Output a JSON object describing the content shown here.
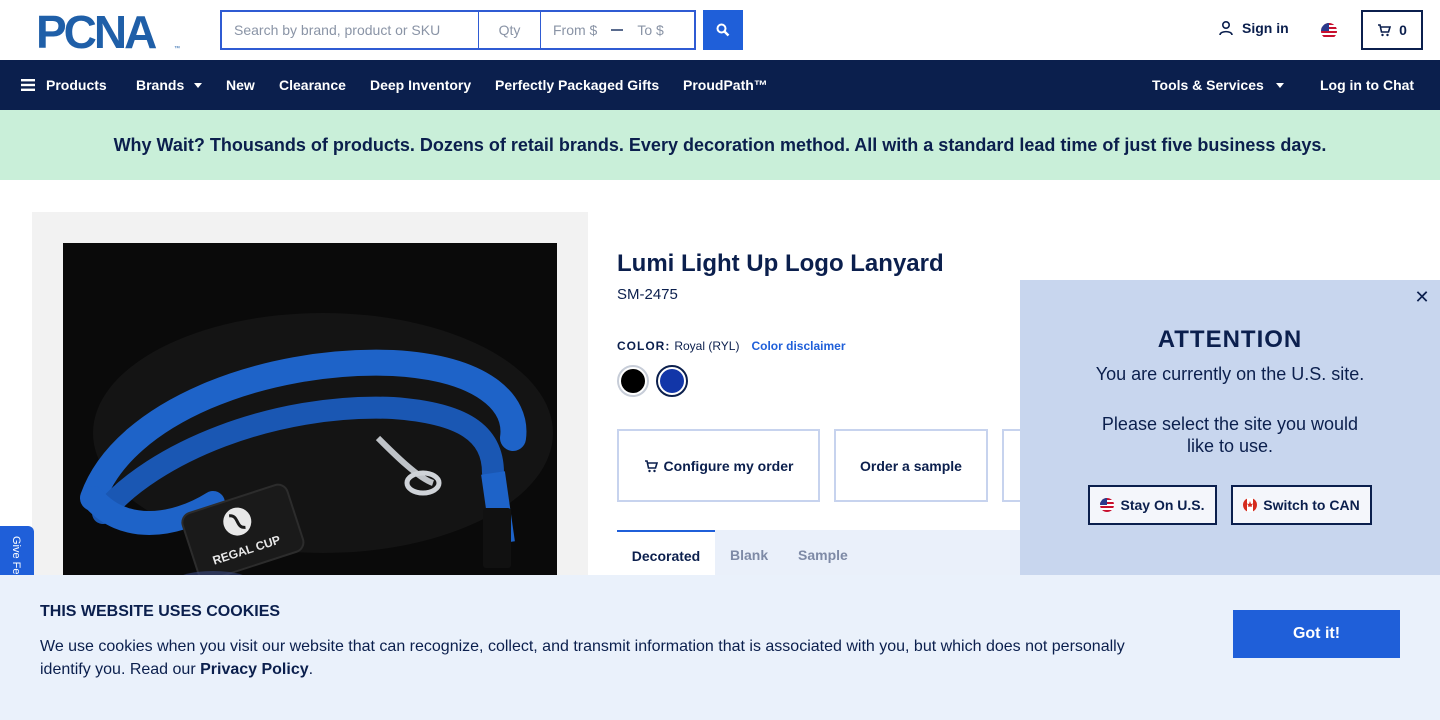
{
  "header": {
    "logo_text": "PCNA",
    "search_placeholder": "Search by brand, product or SKU",
    "qty_placeholder": "Qty",
    "from_placeholder": "From $",
    "to_placeholder": "To $",
    "sign_in": "Sign in",
    "cart_count": "0"
  },
  "nav": {
    "products": "Products",
    "brands": "Brands",
    "new": "New",
    "clearance": "Clearance",
    "deep_inventory": "Deep Inventory",
    "gifts": "Perfectly Packaged Gifts",
    "proudpath": "ProudPath™",
    "tools": "Tools & Services",
    "chat": "Log in to Chat"
  },
  "banner": {
    "text": "Why Wait? Thousands of products. Dozens of retail brands. Every decoration method. All with a standard lead time of just five business days."
  },
  "product": {
    "title": "Lumi Light Up Logo Lanyard",
    "sku": "SM-2475",
    "color_label": "COLOR:",
    "color_value": "Royal (RYL)",
    "color_disclaimer": "Color disclaimer",
    "swatches": [
      {
        "name": "Black",
        "color": "#000000"
      },
      {
        "name": "Royal",
        "color": "#1236a8"
      }
    ],
    "image_logo_text": "REGAL CUP",
    "actions": {
      "configure": "Configure my order",
      "sample": "Order a sample"
    },
    "tabs": [
      "Decorated",
      "Blank",
      "Sample"
    ]
  },
  "feedback": "Give Feedback",
  "popup": {
    "title": "ATTENTION",
    "line1": "You are currently on the U.S. site.",
    "line2": "Please select the site you would like to use.",
    "stay": "Stay On U.S.",
    "switch": "Switch to CAN"
  },
  "cookie": {
    "title": "THIS WEBSITE USES COOKIES",
    "text": "We use cookies when you visit our website that can recognize, collect, and transmit information that is associated with you, but which does not personally identify you. Read our ",
    "link": "Privacy Policy",
    "end": ".",
    "button": "Got it!"
  },
  "colors": {
    "navy": "#0b1f4d",
    "accent": "#1f5fd9",
    "banner_bg": "#c9efd9",
    "popup_bg": "#c8d6ee"
  }
}
